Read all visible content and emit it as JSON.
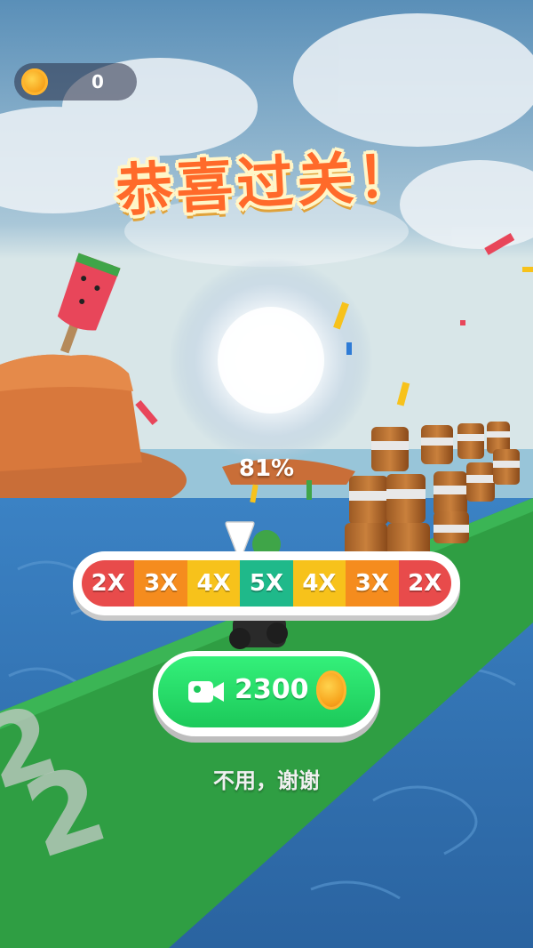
{
  "hud": {
    "coin_count": "0"
  },
  "title": "恭喜过关！",
  "progress": {
    "label": "81%",
    "value": 0.81
  },
  "multiplier": {
    "segments": [
      {
        "label": "2X",
        "color": "#e84b4b"
      },
      {
        "label": "3X",
        "color": "#f58c1e"
      },
      {
        "label": "4X",
        "color": "#f7c21b"
      },
      {
        "label": "5X",
        "color": "#1fb98a"
      },
      {
        "label": "4X",
        "color": "#f7c21b"
      },
      {
        "label": "3X",
        "color": "#f58c1e"
      },
      {
        "label": "2X",
        "color": "#e84b4b"
      }
    ]
  },
  "reward_button": {
    "amount": "2300",
    "icon": "video-camera-icon"
  },
  "no_thanks": "不用，谢谢",
  "colors": {
    "sky_top": "#5a8fb8",
    "water": "#2f6fae",
    "track_green": "#2f9e43",
    "title_orange": "#ff6a2a",
    "button_green": "#1cc95a"
  }
}
